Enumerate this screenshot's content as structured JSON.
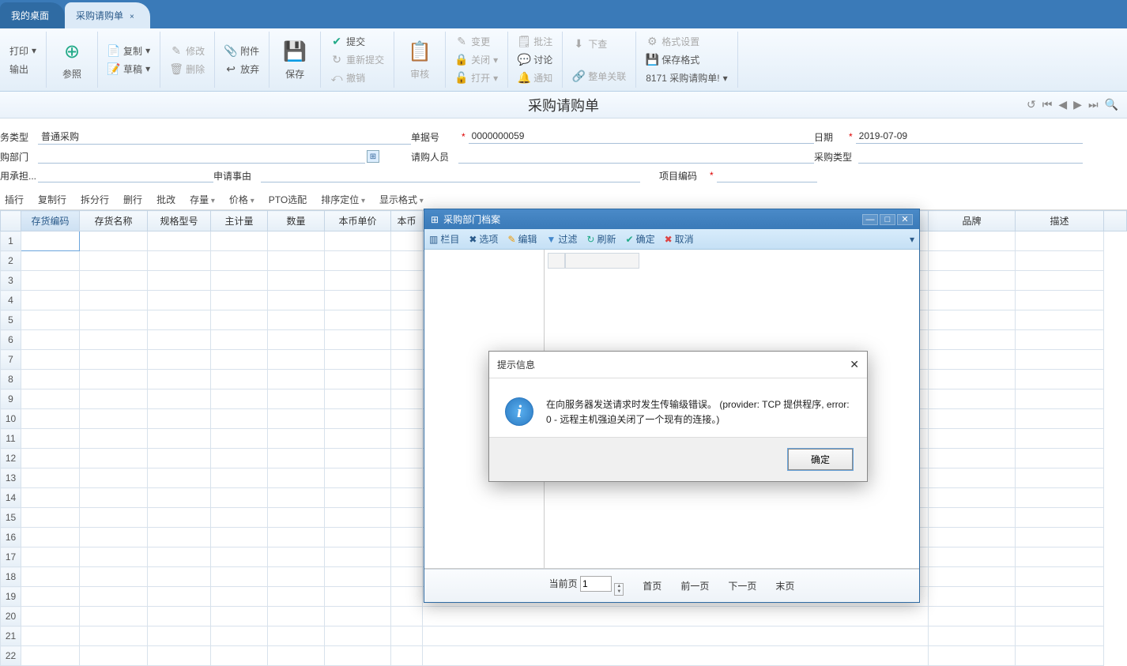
{
  "tabs": [
    {
      "label": "我的桌面",
      "active": false
    },
    {
      "label": "采购请购单",
      "active": true
    }
  ],
  "ribbon": {
    "print": "打印",
    "output": "输出",
    "ref": "参照",
    "copy": "复制",
    "edit": "修改",
    "attach": "附件",
    "draft": "草稿",
    "delete": "删除",
    "abandon": "放弃",
    "save": "保存",
    "submit": "提交",
    "resubmit": "重新提交",
    "revoke": "撤销",
    "audit": "审核",
    "change": "变更",
    "close": "关闭",
    "open": "打开",
    "batch_approve": "批注",
    "discuss": "讨论",
    "notify": "通知",
    "check": "下查",
    "related": "整单关联",
    "format": "格式设置",
    "save_format": "保存格式",
    "template": "8171 采购请购单!"
  },
  "doc_title": "采购请购单",
  "nav_icons": {
    "undo": "↺",
    "first": "⏮",
    "prev": "◀",
    "next": "▶",
    "last": "⏭",
    "search": "🔍"
  },
  "form": {
    "biz_type_label": "务类型",
    "biz_type_value": "普通采购",
    "dept_label": "购部门",
    "dept_value": "",
    "expense_label": "用承担...",
    "expense_value": "",
    "docno_label": "单据号",
    "docno_value": "0000000059",
    "requester_label": "请购人员",
    "requester_value": "",
    "reason_label": "申请事由",
    "reason_value": "",
    "date_label": "日期",
    "date_value": "2019-07-09",
    "purchase_type_label": "采购类型",
    "purchase_type_value": "",
    "project_label": "项目编码",
    "project_value": ""
  },
  "actions": {
    "insert_row": "插行",
    "copy_row": "复制行",
    "split_row": "拆分行",
    "del_row": "删行",
    "batch": "批改",
    "inventory": "存量",
    "price": "价格",
    "pto": "PTO选配",
    "sort": "排序定位",
    "display": "显示格式"
  },
  "grid": {
    "cols": [
      "",
      "存货编码",
      "存货名称",
      "规格型号",
      "主计量",
      "数量",
      "本币单价",
      "本币",
      "品牌",
      "描述"
    ],
    "widths": [
      26,
      74,
      86,
      80,
      72,
      72,
      84,
      40,
      110,
      112
    ],
    "rows": 22
  },
  "archive": {
    "title": "采购部门档案",
    "toolbar": {
      "columns": "栏目",
      "options": "选项",
      "edit": "编辑",
      "filter": "过滤",
      "refresh": "刷新",
      "ok": "确定",
      "cancel": "取消"
    },
    "footer": {
      "page_label": "当前页",
      "page_value": "1",
      "first": "首页",
      "prev": "前一页",
      "next": "下一页",
      "last": "末页"
    }
  },
  "error": {
    "title": "提示信息",
    "message": "在向服务器发送请求时发生传输级错误。 (provider: TCP 提供程序, error: 0 - 远程主机强迫关闭了一个现有的连接。)",
    "ok": "确定"
  }
}
